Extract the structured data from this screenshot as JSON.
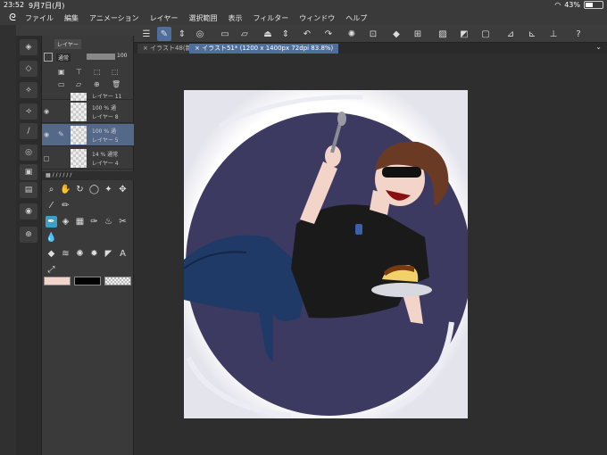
{
  "status": {
    "time": "23:52",
    "date": "9月7日(月)",
    "battery": "43%",
    "battery_level": 0.43
  },
  "menu": [
    "ファイル",
    "編集",
    "アニメーション",
    "レイヤー",
    "選択範囲",
    "表示",
    "フィルター",
    "ウィンドウ",
    "ヘルプ"
  ],
  "tabs": [
    {
      "label": "× イラスト48(新..."
    },
    {
      "label": "× イラスト51* (1200 x 1400px 72dpi 83.8%)"
    }
  ],
  "layer_panel": {
    "title": "レイヤー",
    "blend_mode": "通常",
    "opacity": "100",
    "layers": [
      {
        "opacity": "",
        "name": "レイヤー 11",
        "visible": false,
        "selected": false
      },
      {
        "opacity": "100 % 通",
        "name": "レイヤー 8",
        "visible": true,
        "selected": false
      },
      {
        "opacity": "100 % 通",
        "name": "レイヤー 5",
        "visible": true,
        "selected": true
      },
      {
        "opacity": "14 % 通常",
        "name": "レイヤー 4",
        "visible": false,
        "selected": false
      }
    ]
  },
  "colors": {
    "main": "#f2d4c8",
    "sub": "#000000",
    "background_circle": "#3d3a62",
    "shirt": "#1a1a1a",
    "jeans": "#1f3a66",
    "hair": "#6b3a24",
    "accent": "#4f6f9a",
    "active_tool": "#3aa0c8"
  }
}
